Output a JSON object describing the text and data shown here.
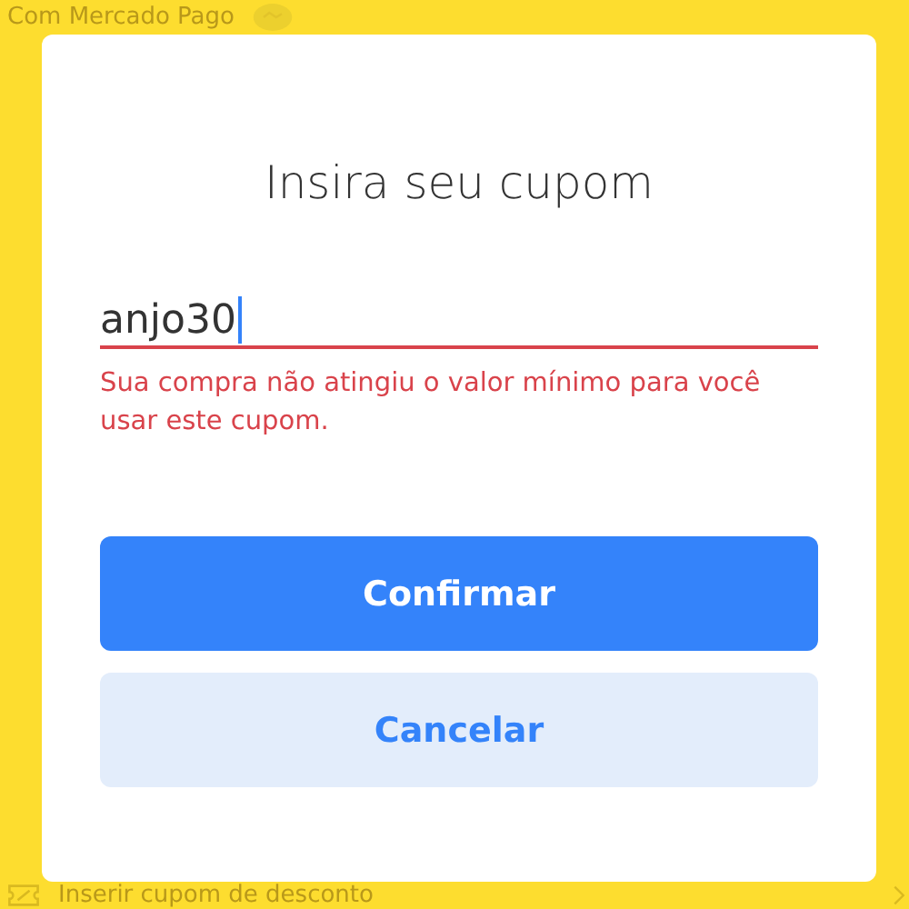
{
  "background": {
    "header_text": "Com Mercado Pago",
    "footer_text": "Inserir cupom de desconto"
  },
  "dialog": {
    "title": "Insira seu cupom",
    "field": {
      "value": "anjo30",
      "focused": true,
      "error": true
    },
    "error_message": "Sua compra não atingiu o valor mínimo para você usar este cupom.",
    "buttons": [
      {
        "label": "Confirmar",
        "kind": "primary"
      },
      {
        "label": "Cancelar",
        "kind": "secondary"
      }
    ]
  }
}
